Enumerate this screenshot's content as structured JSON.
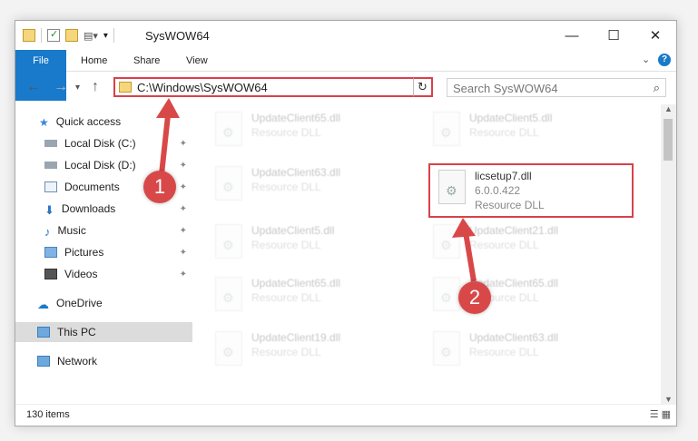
{
  "window": {
    "title": "SysWOW64"
  },
  "ribbon": {
    "tabs": [
      "File",
      "Home",
      "Share",
      "View"
    ]
  },
  "controls": {
    "minimize": "—",
    "maximize": "☐",
    "close": "✕",
    "help": "?"
  },
  "address": {
    "path": "C:\\Windows\\SysWOW64",
    "dropdown": "⌄",
    "refresh": "↻"
  },
  "search": {
    "placeholder": "Search SysWOW64"
  },
  "sidebar": {
    "items": [
      {
        "label": "Quick access",
        "icon": "star-icon"
      },
      {
        "label": "Local Disk (C:)",
        "icon": "drive-icon",
        "pinned": true
      },
      {
        "label": "Local Disk (D:)",
        "icon": "drive-icon",
        "pinned": true
      },
      {
        "label": "Documents",
        "icon": "documents-icon",
        "pinned": true
      },
      {
        "label": "Downloads",
        "icon": "downloads-icon",
        "pinned": true
      },
      {
        "label": "Music",
        "icon": "music-icon",
        "pinned": true
      },
      {
        "label": "Pictures",
        "icon": "pictures-icon",
        "pinned": true
      },
      {
        "label": "Videos",
        "icon": "videos-icon",
        "pinned": true
      },
      {
        "label": "OneDrive",
        "icon": "cloud-icon"
      },
      {
        "label": "This PC",
        "icon": "pc-icon",
        "selected": true
      },
      {
        "label": "Network",
        "icon": "network-icon"
      }
    ]
  },
  "files": [
    {
      "name": "UpdateClient65.dll",
      "type": "Resource DLL"
    },
    {
      "name": "UpdateClient5.dll",
      "type": "Resource DLL"
    },
    {
      "name": "UpdateClient63.dll",
      "type": "Resource DLL"
    },
    {
      "name": "licsetup7.dll",
      "version": "6.0.0.422",
      "type": "Resource DLL"
    },
    {
      "name": "UpdateClient5.dll",
      "type": "Resource DLL"
    },
    {
      "name": "UpdateClient21.dll",
      "type": "Resource DLL"
    },
    {
      "name": "UpdateClient65.dll",
      "type": "Resource DLL"
    },
    {
      "name": "UpdateClient65.dll",
      "type": "Resource DLL"
    },
    {
      "name": "UpdateClient19.dll",
      "type": "Resource DLL"
    },
    {
      "name": "UpdateClient63.dll",
      "type": "Resource DLL"
    }
  ],
  "status": {
    "count": "130 items"
  },
  "annotations": {
    "badge1": "1",
    "badge2": "2",
    "color": "#d94848"
  }
}
